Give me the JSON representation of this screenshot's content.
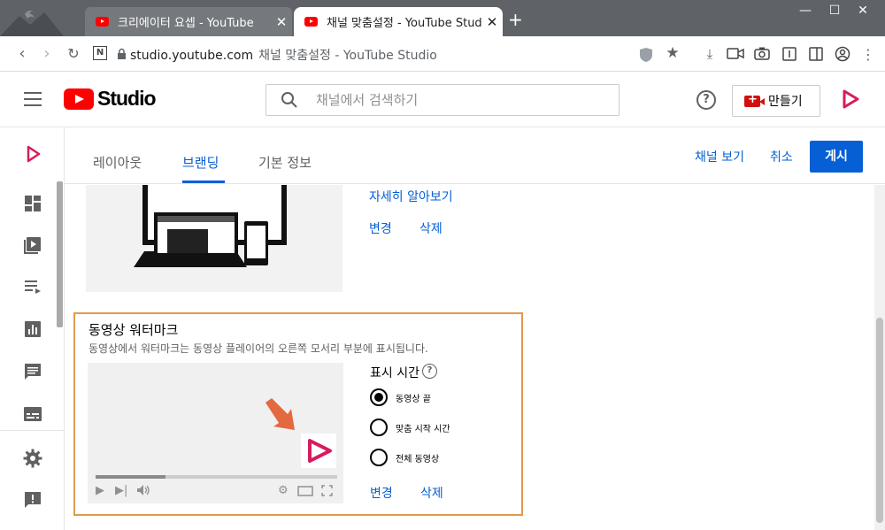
{
  "browser": {
    "tabs": [
      {
        "title": "크리에이터 요셉 - YouTube",
        "active": false
      },
      {
        "title": "채널 맞춤설정 - YouTube Studio",
        "active": true
      }
    ],
    "new_tab_label": "+",
    "url_host": "studio.youtube.com",
    "url_page_title": "채널 맞춤설정 - YouTube Studio"
  },
  "header": {
    "logo_text": "Studio",
    "search_placeholder": "채널에서 검색하기",
    "help_label": "?",
    "create_label": "만들기"
  },
  "tabs": {
    "items": [
      "레이아웃",
      "브랜딩",
      "기본 정보"
    ],
    "selected": "브랜딩",
    "view_channel": "채널 보기",
    "cancel": "취소",
    "publish": "게시"
  },
  "banner": {
    "learn_more": "자세히 알아보기",
    "change": "변경",
    "delete": "삭제"
  },
  "watermark": {
    "title": "동영상 워터마크",
    "description": "동영상에서 워터마크는 동영상 플레이어의 오른쪽 모서리 부분에 표시됩니다.",
    "display_time_label": "표시 시간",
    "options": [
      {
        "label": "동영상 끝",
        "selected": true
      },
      {
        "label": "맞춤 시작 시간",
        "selected": false
      },
      {
        "label": "전체 동영상",
        "selected": false
      }
    ],
    "progress_fraction": 0.29,
    "change": "변경",
    "delete": "삭제"
  },
  "colors": {
    "accent": "#065fd4",
    "youtube_red": "#ff0000",
    "highlight_border": "#e29a4a",
    "brand_pink": "#d81b60"
  }
}
